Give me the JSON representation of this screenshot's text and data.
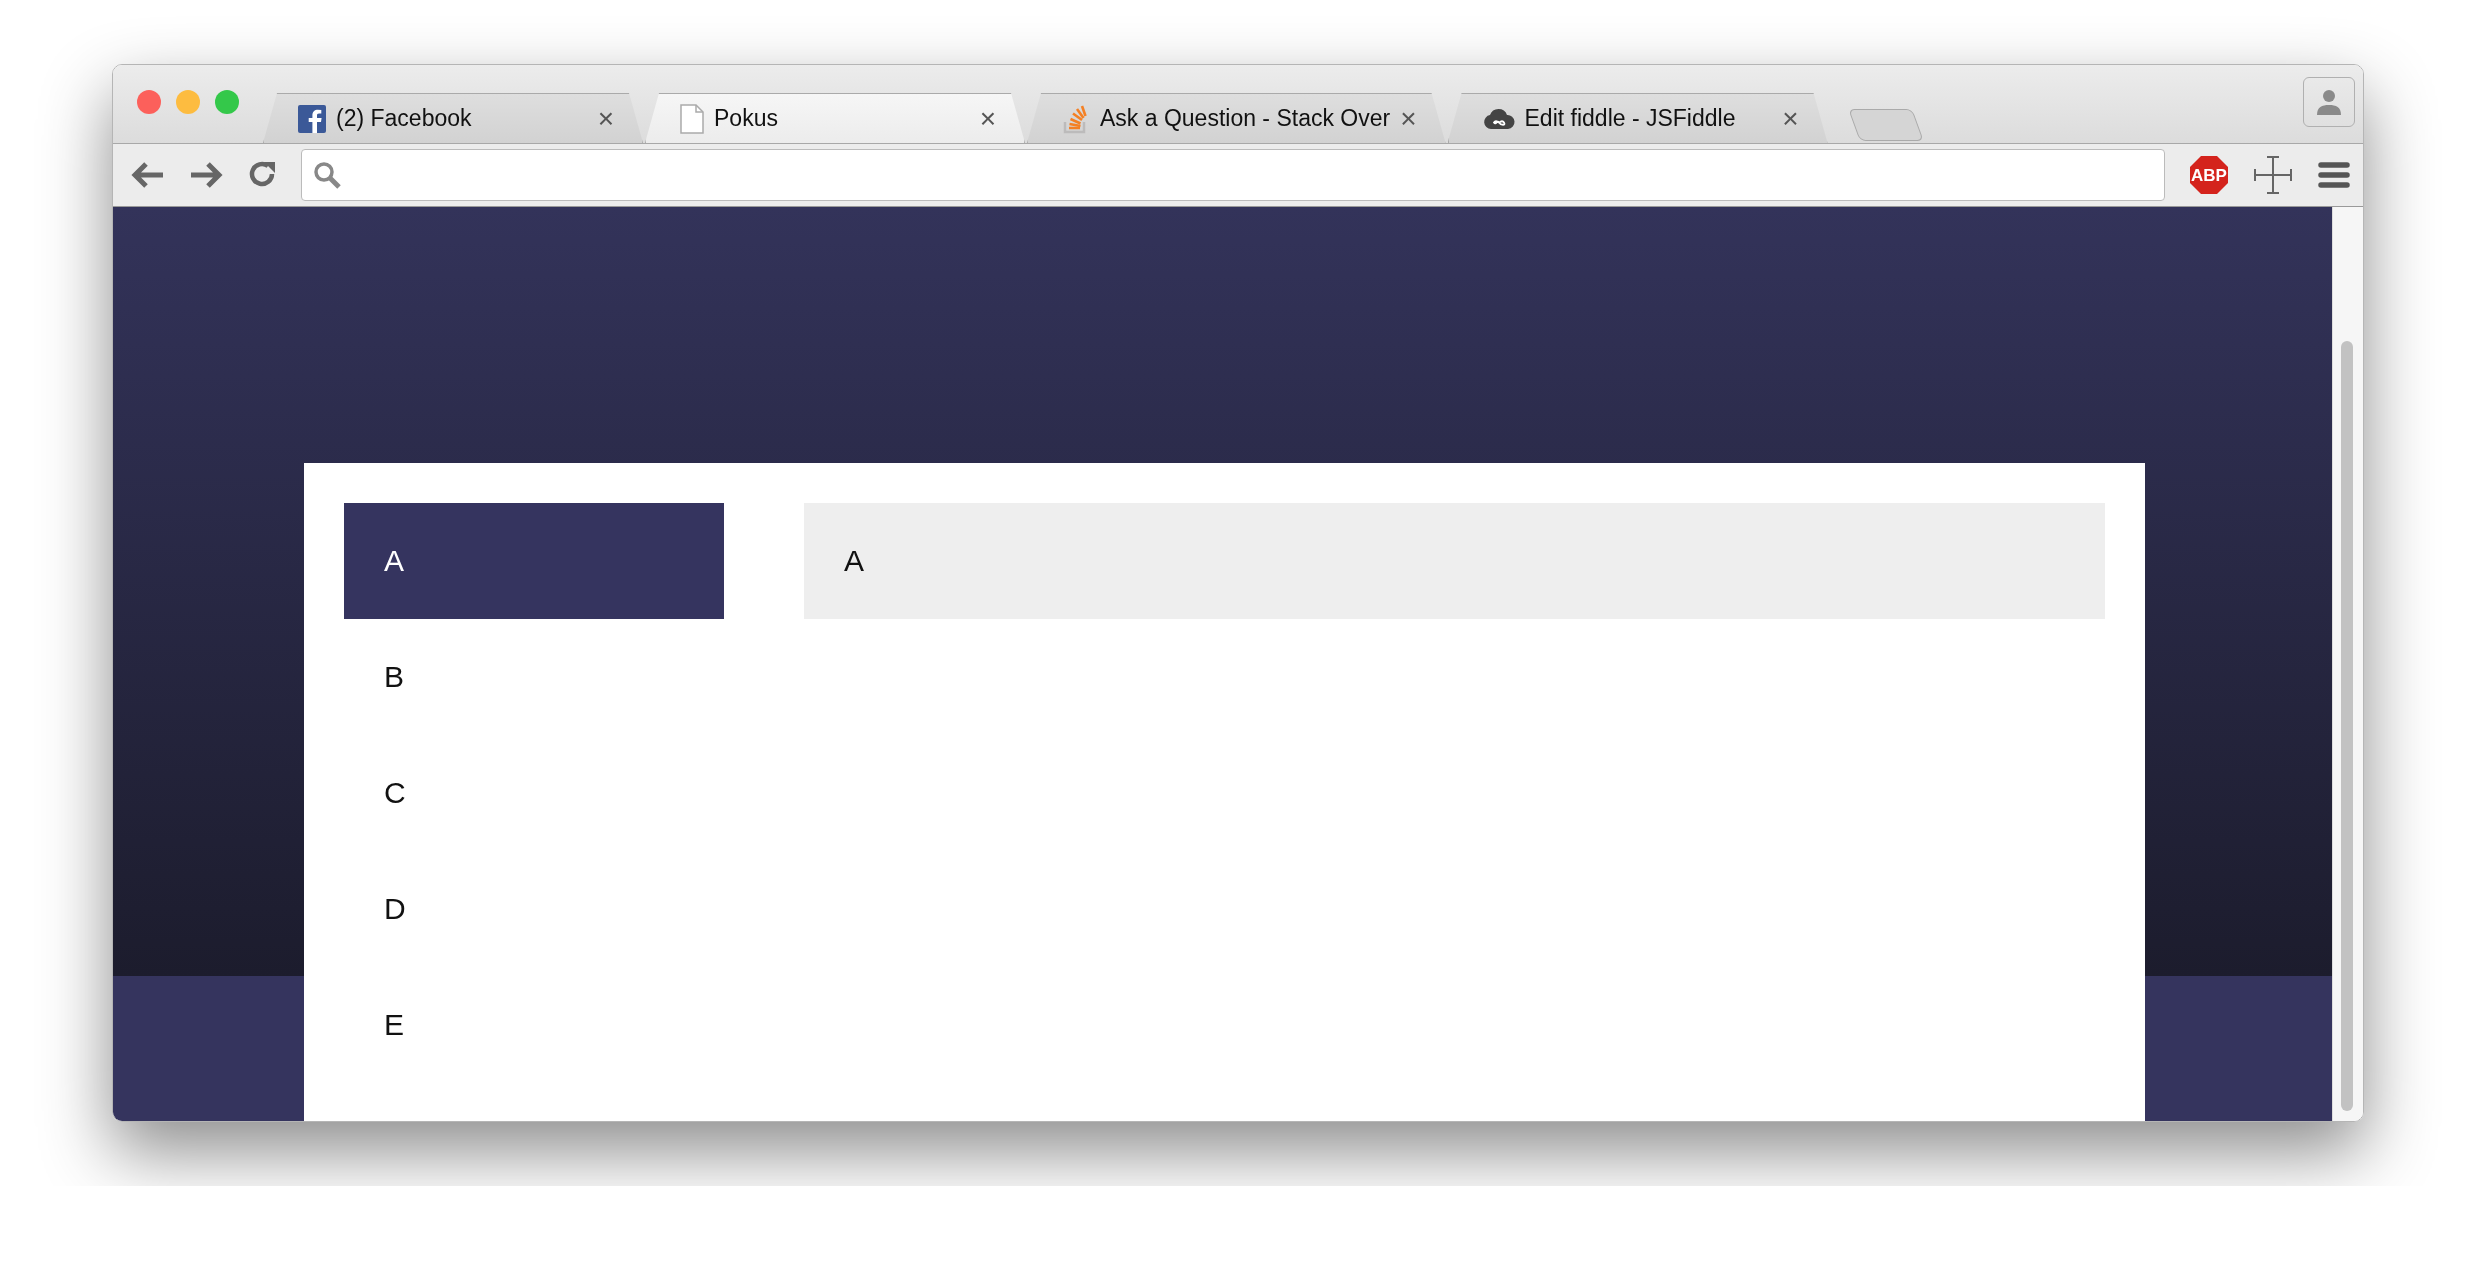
{
  "window": {
    "tabs": [
      {
        "title": "(2) Facebook",
        "close": "×",
        "selected": false
      },
      {
        "title": "Pokus",
        "close": "×",
        "selected": true
      },
      {
        "title": "Ask a Question - Stack Over",
        "close": "×",
        "selected": false
      },
      {
        "title": "Edit fiddle - JSFiddle",
        "close": "×",
        "selected": false
      }
    ],
    "toolbar": {
      "adblock_label": "ABP"
    }
  },
  "page": {
    "menu": [
      {
        "label": "A",
        "selected": true
      },
      {
        "label": "B",
        "selected": false
      },
      {
        "label": "C",
        "selected": false
      },
      {
        "label": "D",
        "selected": false
      },
      {
        "label": "E",
        "selected": false
      }
    ],
    "panel": {
      "text": "A"
    }
  }
}
